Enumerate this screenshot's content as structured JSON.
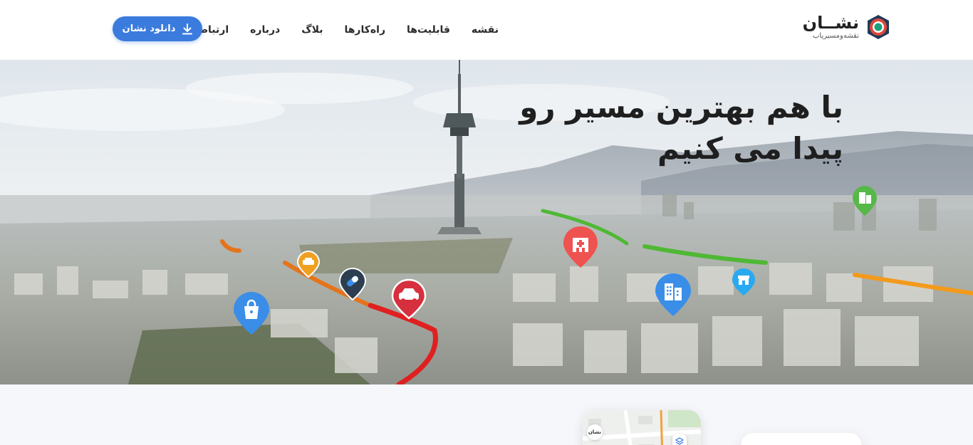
{
  "brand": {
    "name": "نشــان",
    "tagline": "نقشه‌ومسیریاب",
    "colors": {
      "ring": "#e0473a",
      "core": "#1e9e7b",
      "dark": "#1f3b57"
    }
  },
  "nav": {
    "items": [
      {
        "label": "نقشه"
      },
      {
        "label": "قابلیت‌ها"
      },
      {
        "label": "راه‌کارها"
      },
      {
        "label": "بلاگ"
      },
      {
        "label": "درباره"
      },
      {
        "label": "ارتباط با ما"
      }
    ]
  },
  "download_button": {
    "label": "دانلود نشان",
    "icon": "download-icon",
    "color": "#3a7bdd"
  },
  "hero": {
    "title_line1": "با هم بهترین مسیر رو",
    "title_line2": "پیدا می کنیم",
    "pins": [
      {
        "name": "shopping-bag-pin",
        "icon": "shopping-bag-icon",
        "color": "#3a8ee8"
      },
      {
        "name": "taxi-pin",
        "icon": "taxi-icon",
        "color": "#f0a020"
      },
      {
        "name": "pharmacy-pin",
        "icon": "pill-icon",
        "color": "#2c3e50"
      },
      {
        "name": "traffic-car-pin",
        "icon": "car-icon",
        "color": "#d62f3d"
      },
      {
        "name": "hospital-pin",
        "icon": "hospital-icon",
        "color": "#ef5350"
      },
      {
        "name": "office-building-pin",
        "icon": "building-icon",
        "color": "#3a8ee8"
      },
      {
        "name": "store-pin",
        "icon": "store-icon",
        "color": "#29a9f0"
      },
      {
        "name": "green-building-pin",
        "icon": "building-icon",
        "color": "#55b848"
      }
    ],
    "route_colors": {
      "slow": "#e5731c",
      "jam": "#e02020",
      "free": "#4fb834",
      "medium": "#f39a1c"
    }
  },
  "preview": {
    "map_badge": "نشان"
  }
}
